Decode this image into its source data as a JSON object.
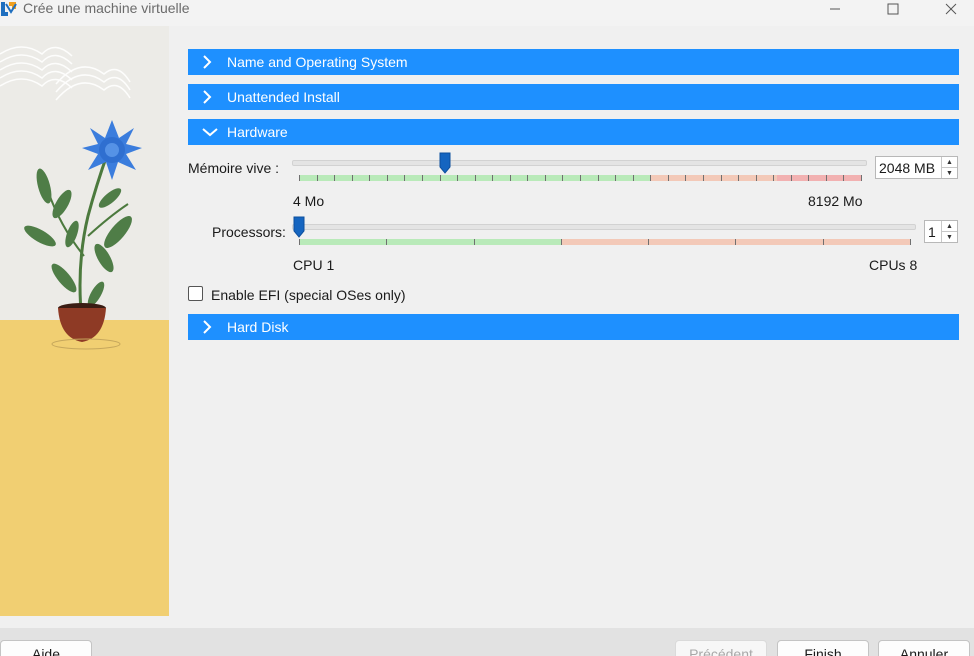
{
  "window": {
    "title": "Crée une machine virtuelle",
    "controls": [
      "minimize-icon",
      "maximize-icon",
      "close-icon"
    ]
  },
  "sections": {
    "name_os": "Name and Operating System",
    "unattended": "Unattended Install",
    "hardware": "Hardware",
    "hard_disk": "Hard Disk"
  },
  "hardware": {
    "memory": {
      "label": "Mémoire vive :",
      "value": 2048,
      "value_text": "2048 MB",
      "min_label": "4 Mo",
      "max_label": "8192 Mo",
      "min": 4,
      "max": 8192
    },
    "processors": {
      "label": "Processors:",
      "value": 1,
      "value_text": "1",
      "min_label": "CPU 1",
      "max_label": "CPUs 8",
      "min": 1,
      "max": 8
    },
    "efi_label": "Enable EFI (special OSes only)",
    "efi_checked": false
  },
  "buttons": {
    "help": "Aide",
    "back": "Précédent",
    "finish": "Finish",
    "cancel": "Annuler"
  },
  "colors": {
    "accent": "#1e90ff",
    "slider_ok": "#b9eab9",
    "slider_warn": "#f3c9b8",
    "slider_bad": "#f2b1b1",
    "handle": "#1565c0"
  }
}
